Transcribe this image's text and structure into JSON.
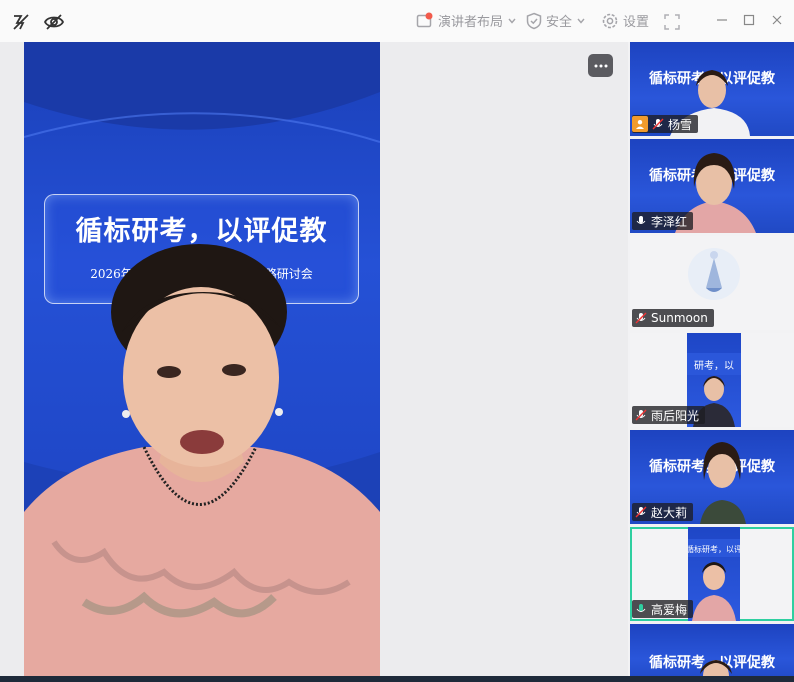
{
  "toolbar": {
    "layout_label": "演讲者布局",
    "security_label": "安全",
    "settings_label": "设置"
  },
  "main": {
    "banner_title": "循标研考，以评促教",
    "banner_subtitle": "2026年中考英语……课堂教学策略研讨会"
  },
  "participants": [
    {
      "name": "杨雪",
      "host": true,
      "video": "blue"
    },
    {
      "name": "李泽红",
      "host": false,
      "video": "blue"
    },
    {
      "name": "Sunmoon",
      "host": false,
      "video": "avatar"
    },
    {
      "name": "雨后阳光",
      "host": false,
      "video": "narrow"
    },
    {
      "name": "赵大莉",
      "host": false,
      "video": "blue"
    },
    {
      "name": "高爱梅",
      "host": false,
      "video": "narrow",
      "active": true
    },
    {
      "name": "",
      "host": false,
      "video": "blue"
    }
  ],
  "thumb_titles": {
    "t1": "循标研考，以评促教",
    "t2": "循标研考，以评促教",
    "t5": "循标研考，以评促教",
    "t7": "循标研考，以评促教"
  },
  "colors": {
    "accent_active": "#2ecfa0",
    "host_badge": "#f19b2c",
    "video_blue": "#2551d6"
  }
}
